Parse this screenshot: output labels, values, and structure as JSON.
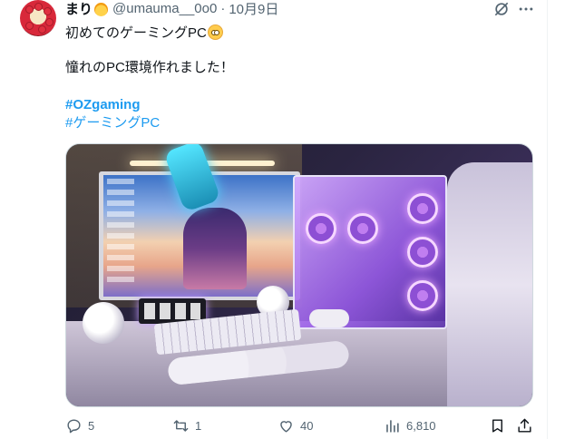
{
  "tweet": {
    "display_name": "まり",
    "handle": "@umauma__0o0",
    "separator": "·",
    "date": "10月9日",
    "text_line1": "初めてのゲーミングPC",
    "text_line2": "憧れのPC環境作れました！",
    "hashtag1": "#OZgaming",
    "hashtag2": "#ゲーミングPC"
  },
  "metrics": {
    "replies": "5",
    "retweets": "1",
    "likes": "40",
    "views": "6,810"
  },
  "icons": {
    "avatar": "strawberry-cake-avatar",
    "name_emoji": "blonde-hair-emoji",
    "text_emoji": "pleading-face-emoji",
    "grok": "grok-icon",
    "more": "more-icon",
    "reply": "reply-icon",
    "retweet": "retweet-icon",
    "like": "heart-icon",
    "views": "views-icon",
    "bookmark": "bookmark-icon",
    "share": "share-icon"
  },
  "colors": {
    "text": "#0f1419",
    "secondary": "#536471",
    "link": "#1d9bf0"
  }
}
